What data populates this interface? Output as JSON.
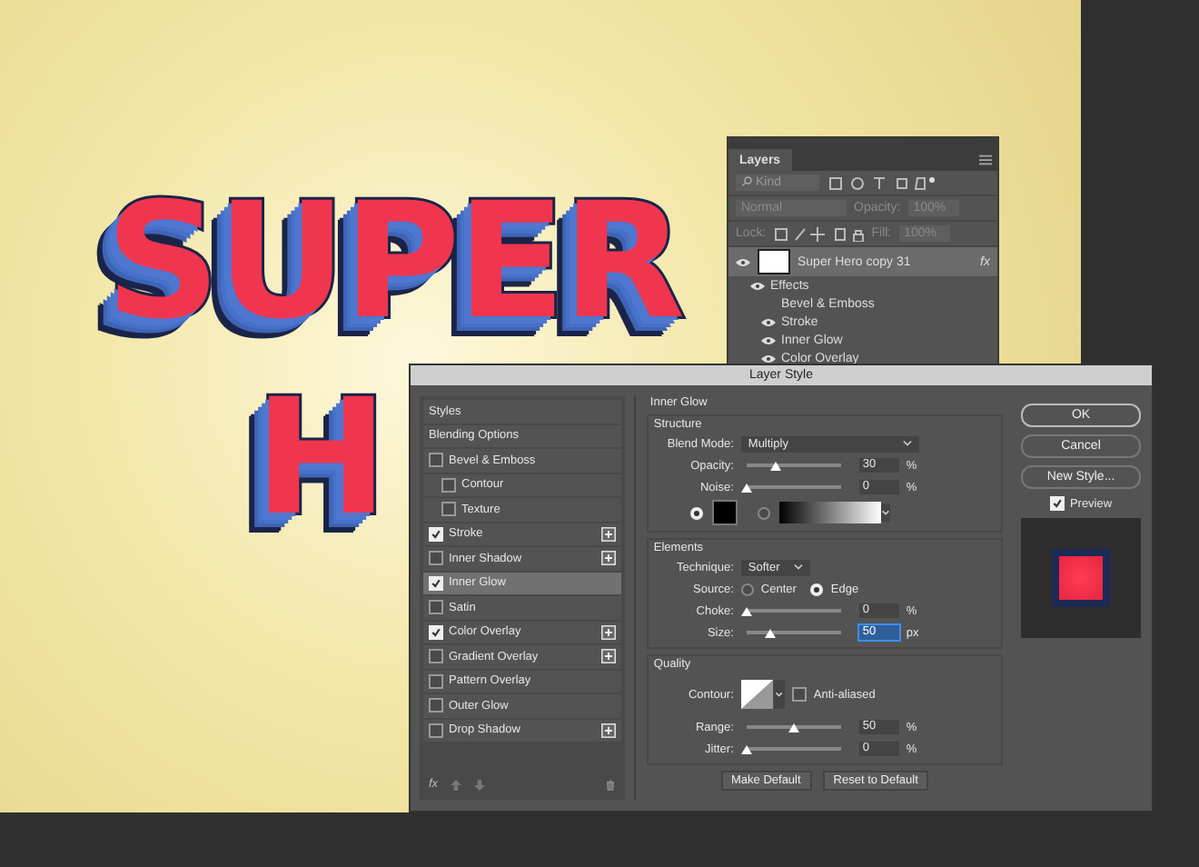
{
  "canvas": {
    "headline_lines": [
      "SUPER",
      "H"
    ]
  },
  "layers_panel": {
    "title": "Layers",
    "filter_placeholder": "Kind",
    "blend_mode": "Normal",
    "opacity_label": "Opacity:",
    "opacity_value": "100%",
    "lock_label": "Lock:",
    "fill_label": "Fill:",
    "fill_value": "100%",
    "layer": {
      "name": "Super Hero copy 31",
      "fx": "fx",
      "selected": true
    },
    "effects_label": "Effects",
    "effects": [
      {
        "name": "Bevel & Emboss",
        "visible": false
      },
      {
        "name": "Stroke",
        "visible": true
      },
      {
        "name": "Inner Glow",
        "visible": true
      },
      {
        "name": "Color Overlay",
        "visible": true
      }
    ]
  },
  "dialog": {
    "title": "Layer Style",
    "styles": [
      {
        "label": "Styles",
        "kind": "header",
        "selected": false
      },
      {
        "label": "Blending Options",
        "kind": "header",
        "selected": false
      },
      {
        "label": "Bevel & Emboss",
        "kind": "effect",
        "checked": false,
        "add": false,
        "selected": false
      },
      {
        "label": "Contour",
        "kind": "sub",
        "checked": false,
        "add": false,
        "selected": false
      },
      {
        "label": "Texture",
        "kind": "sub",
        "checked": false,
        "add": false,
        "selected": false
      },
      {
        "label": "Stroke",
        "kind": "effect",
        "checked": true,
        "add": true,
        "selected": false
      },
      {
        "label": "Inner Shadow",
        "kind": "effect",
        "checked": false,
        "add": true,
        "selected": false
      },
      {
        "label": "Inner Glow",
        "kind": "effect",
        "checked": true,
        "add": false,
        "selected": true
      },
      {
        "label": "Satin",
        "kind": "effect",
        "checked": false,
        "add": false,
        "selected": false
      },
      {
        "label": "Color Overlay",
        "kind": "effect",
        "checked": true,
        "add": true,
        "selected": false
      },
      {
        "label": "Gradient Overlay",
        "kind": "effect",
        "checked": false,
        "add": true,
        "selected": false
      },
      {
        "label": "Pattern Overlay",
        "kind": "effect",
        "checked": false,
        "add": false,
        "selected": false
      },
      {
        "label": "Outer Glow",
        "kind": "effect",
        "checked": false,
        "add": false,
        "selected": false
      },
      {
        "label": "Drop Shadow",
        "kind": "effect",
        "checked": false,
        "add": true,
        "selected": false
      }
    ],
    "list_footer": {
      "fx": "fx"
    },
    "section_title": "Inner Glow",
    "structure": {
      "title": "Structure",
      "blend_mode_label": "Blend Mode:",
      "blend_mode": "Multiply",
      "sliders": [
        {
          "label": "Opacity:",
          "level": 0.3,
          "value": "30",
          "unit": "%",
          "focused": false
        },
        {
          "label": "Noise:",
          "level": 0,
          "value": "0",
          "unit": "%",
          "focused": false
        }
      ],
      "color_options": [
        {
          "kind": "solid",
          "selected": true
        },
        {
          "kind": "gradient",
          "selected": false
        }
      ]
    },
    "elements": {
      "title": "Elements",
      "technique_label": "Technique:",
      "technique": "Softer",
      "source_label": "Source:",
      "sources": [
        {
          "label": "Center",
          "selected": false
        },
        {
          "label": "Edge",
          "selected": true
        }
      ],
      "sliders": [
        {
          "label": "Choke:",
          "level": 0,
          "value": "0",
          "unit": "%",
          "focused": false
        },
        {
          "label": "Size:",
          "level": 0.25,
          "value": "50",
          "unit": "px",
          "focused": true
        }
      ]
    },
    "quality": {
      "title": "Quality",
      "contour_label": "Contour:",
      "anti_aliased": {
        "label": "Anti-aliased",
        "checked": false
      },
      "sliders": [
        {
          "label": "Range:",
          "level": 0.5,
          "value": "50",
          "unit": "%",
          "focused": false
        },
        {
          "label": "Jitter:",
          "level": 0,
          "value": "0",
          "unit": "%",
          "focused": false
        }
      ]
    },
    "bottom_buttons": [
      "Make Default",
      "Reset to Default"
    ],
    "buttons": [
      {
        "label": "OK",
        "default": true
      },
      {
        "label": "Cancel",
        "default": false
      },
      {
        "label": "New Style...",
        "default": false
      }
    ],
    "preview": {
      "label": "Preview",
      "checked": true
    }
  }
}
